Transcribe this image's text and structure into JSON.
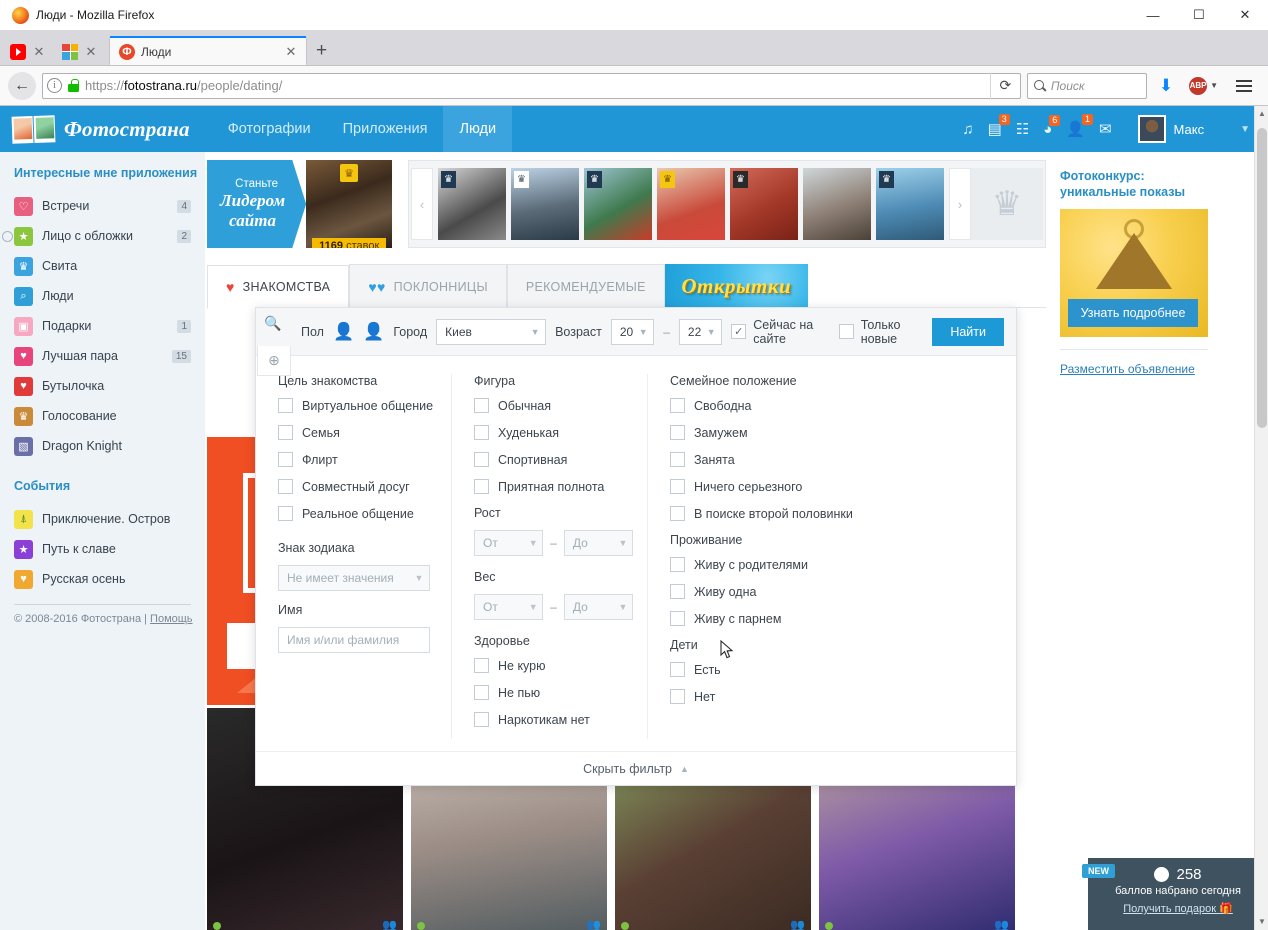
{
  "browser": {
    "window_title": "Люди - Mozilla Firefox",
    "tabs": [
      {
        "label": "",
        "favicon": "youtube-icon"
      },
      {
        "label": "",
        "favicon": "apps-grid-icon"
      },
      {
        "label": "Люди",
        "favicon": "fotostrana-icon",
        "active": true
      }
    ],
    "new_tab_label": "+",
    "close_label": "✕",
    "minimize_label": "—",
    "maximize_label": "☐",
    "window_close_label": "✕",
    "back_label": "←",
    "url_scheme": "https://",
    "url_host": "fotostrana.ru",
    "url_path": "/people/dating/",
    "reload_label": "⟳",
    "search_placeholder": "Поиск",
    "download_label": "⬇",
    "abp_label": "ABP",
    "menu_label": "☰"
  },
  "header": {
    "brand": "Фотострана",
    "nav": [
      {
        "label": "Фотографии",
        "active": false
      },
      {
        "label": "Приложения",
        "active": false
      },
      {
        "label": "Люди",
        "active": true
      }
    ],
    "icons": [
      {
        "name": "music-icon",
        "glyph": "♫",
        "badge": ""
      },
      {
        "name": "news-feed-icon",
        "glyph": "▤",
        "badge": "3"
      },
      {
        "name": "list-icon",
        "glyph": "☰",
        "badge": ""
      },
      {
        "name": "notifications-icon",
        "glyph": "◕",
        "badge": "6"
      },
      {
        "name": "friends-icon",
        "glyph": "👥",
        "badge": "1"
      },
      {
        "name": "messages-icon",
        "glyph": "✉",
        "badge": ""
      }
    ],
    "user_name": "Макс",
    "user_caret": "▼"
  },
  "left_sidebar": {
    "apps_title": "Интересные мне приложения",
    "apps": [
      {
        "label": "Встречи",
        "count": "4",
        "color": "#e8607f",
        "glyph": "♡",
        "clock": false
      },
      {
        "label": "Лицо с обложки",
        "count": "2",
        "color": "#8cc63f",
        "glyph": "★",
        "clock": true
      },
      {
        "label": "Свита",
        "count": "",
        "color": "#3ba3dd",
        "glyph": "♛",
        "clock": false
      },
      {
        "label": "Люди",
        "count": "",
        "color": "#2f9fd6",
        "glyph": "🔍",
        "clock": false
      },
      {
        "label": "Подарки",
        "count": "1",
        "color": "#f6a8c0",
        "glyph": "🎁",
        "clock": false
      },
      {
        "label": "Лучшая пара",
        "count": "15",
        "color": "#e8457c",
        "glyph": "♥",
        "clock": false
      },
      {
        "label": "Бутылочка",
        "count": "",
        "color": "#e03a3a",
        "glyph": "♥",
        "clock": false
      },
      {
        "label": "Голосование",
        "count": "",
        "color": "#c98b3a",
        "glyph": "♛",
        "clock": false
      },
      {
        "label": "Dragon Knight",
        "count": "",
        "color": "#6b6fa8",
        "glyph": "🐉",
        "clock": false
      }
    ],
    "events_title": "События",
    "events": [
      {
        "label": "Приключение. Остров",
        "color": "#f2e34a",
        "glyph": "🌴"
      },
      {
        "label": "Путь к славе",
        "color": "#8b3fd6",
        "glyph": "★"
      },
      {
        "label": "Русская осень",
        "color": "#f0a830",
        "glyph": "🍂"
      }
    ],
    "copyright": "© 2008-2016 Фотострана",
    "help_link": "Помощь",
    "divider": "|"
  },
  "leader_banner": {
    "line1": "Станьте",
    "line2": "Лидером",
    "line3": "сайта",
    "bids_count": "1169",
    "bids_word": "ставок",
    "crown_glyph": "♛"
  },
  "photo_strip": {
    "prev_label": "‹",
    "next_label": "›",
    "vip_glyph": "♛",
    "items": [
      {
        "name": "avatar-1",
        "bg": "linear-gradient(150deg,#d8d8d8,#4a4a4a 60%,#8a8a8a)",
        "vip": "#1f3a52"
      },
      {
        "name": "avatar-2",
        "bg": "linear-gradient(170deg,#bcd3e6,#5b6b78 55%,#2b3a46)",
        "vip": "#ffffff"
      },
      {
        "name": "avatar-3",
        "bg": "linear-gradient(150deg,#9ec6d4,#3f7a4e 55%,#c83c28)",
        "vip": "#1f3a52"
      },
      {
        "name": "avatar-4",
        "bg": "linear-gradient(160deg,#e8c9b0,#c94a3a 60%,#d9463a)",
        "vip": "#f5c60f"
      },
      {
        "name": "avatar-5",
        "bg": "linear-gradient(150deg,#d46a5a,#a33828 55%,#7a2218)",
        "vip": "#2a2a2a"
      },
      {
        "name": "avatar-6",
        "bg": "linear-gradient(160deg,#cfd6da,#8d7f74 55%,#4b4138)",
        "vip": ""
      },
      {
        "name": "avatar-7",
        "bg": "linear-gradient(170deg,#9ed1ea,#4e8bb5 55%,#2f5a78)",
        "vip": "#1f3a52"
      }
    ],
    "trophy_glyph": "♛"
  },
  "content_tabs": [
    {
      "label": "ЗНАКОМСТВА",
      "icon": "heart-icon",
      "icon_glyph": "♥",
      "active": true,
      "style": "plain"
    },
    {
      "label": "ПОКЛОННИЦЫ",
      "icon": "two-hearts-icon",
      "icon_glyph": "♥♥",
      "active": false,
      "style": "plain"
    },
    {
      "label": "РЕКОМЕНДУЕМЫЕ",
      "icon": "",
      "icon_glyph": "",
      "active": false,
      "style": "plain"
    },
    {
      "label": "Открытки",
      "icon": "",
      "icon_glyph": "",
      "active": false,
      "style": "banner"
    }
  ],
  "filter_bar": {
    "side_tabs": [
      {
        "name": "search-tab",
        "glyph": "🔍",
        "active": true
      },
      {
        "name": "globe-tab",
        "glyph": "⊕",
        "active": false
      }
    ],
    "gender_label": "Пол",
    "gender_male_glyph": "👤",
    "gender_female_glyph": "👤",
    "city_label": "Город",
    "city_value": "Киев",
    "age_label": "Возраст",
    "age_from": "20",
    "age_to": "22",
    "age_dash": "–",
    "online_label": "Сейчас на сайте",
    "online_checked": true,
    "new_only_label": "Только новые",
    "new_only_checked": false,
    "find_button": "Найти",
    "caret": "▼",
    "check_glyph": "✓"
  },
  "filter_columns": {
    "col1": {
      "goal_title": "Цель знакомства",
      "goal_options": [
        "Виртуальное общение",
        "Семья",
        "Флирт",
        "Совместный досуг",
        "Реальное общение"
      ],
      "zodiac_title": "Знак зодиака",
      "zodiac_value": "Не имеет значения",
      "name_title": "Имя",
      "name_placeholder": "Имя и/или фамилия"
    },
    "col2": {
      "figure_title": "Фигура",
      "figure_options": [
        "Обычная",
        "Худенькая",
        "Спортивная",
        "Приятная полнота"
      ],
      "height_title": "Рост",
      "weight_title": "Вес",
      "range_from": "От",
      "range_to": "До",
      "range_dash": "–",
      "health_title": "Здоровье",
      "health_options": [
        "Не курю",
        "Не пью",
        "Наркотикам нет"
      ]
    },
    "col3": {
      "marital_title": "Семейное положение",
      "marital_options": [
        "Свободна",
        "Замужем",
        "Занята",
        "Ничего серьезного",
        "В поиске второй половинки"
      ],
      "living_title": "Проживание",
      "living_options": [
        "Живу с родителями",
        "Живу одна",
        "Живу с парнем"
      ],
      "children_title": "Дети",
      "children_options": [
        "Есть",
        "Нет"
      ]
    },
    "hide_filter_label": "Скрыть фильтр",
    "hide_filter_caret": "▲"
  },
  "right_sidebar": {
    "promo_title_line1": "Фотоконкурс:",
    "promo_title_line2": "уникальные показы",
    "promo_button": "Узнать подробнее",
    "place_ad_link": "Разместить объявление"
  },
  "profile_cards": [
    {
      "name": "profile-card-1",
      "bg": "linear-gradient(160deg,#2a2a2a,#1a1416 55%,#3a2a2e)"
    },
    {
      "name": "profile-card-2",
      "bg": "linear-gradient(170deg,#d9cfc8,#9b8d86 55%,#4f5a5e)"
    },
    {
      "name": "profile-card-3",
      "bg": "linear-gradient(150deg,#8fb06a,#5a4034 55%,#3a2a22)"
    },
    {
      "name": "profile-card-4",
      "bg": "linear-gradient(160deg,#cbb89a,#7e5aa8 55%,#2c2a6e)"
    }
  ],
  "toast": {
    "new_badge": "NEW",
    "points": "258",
    "subtitle": "баллов набрано сегодня",
    "link": "Получить подарок",
    "gift_glyph": "🎁",
    "collapse_caret": "⌄"
  },
  "scrollbar": {
    "up": "▲",
    "down": "▼"
  },
  "colors": {
    "brand_blue": "#2196d6",
    "accent_orange": "#f26522",
    "find_button": "#1d9ad6",
    "sidebar_bg": "#eef3f7",
    "link_blue": "#2a7fb8"
  }
}
